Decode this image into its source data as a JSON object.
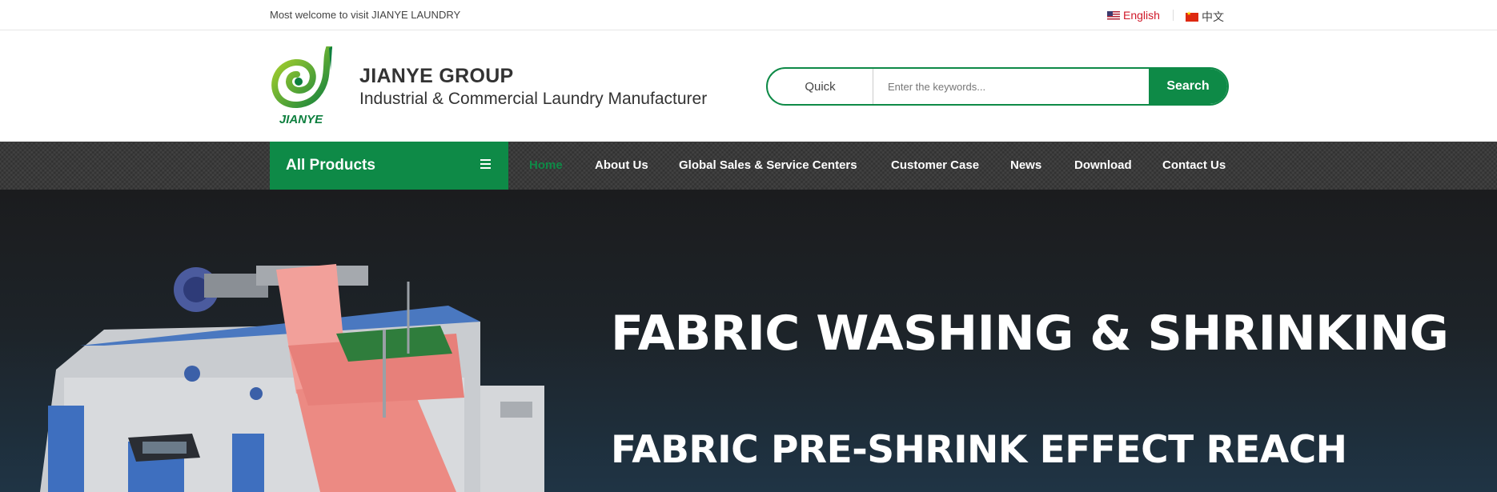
{
  "topbar": {
    "welcome": "Most welcome to visit JIANYE LAUNDRY",
    "lang_en": "English",
    "lang_cn": "中文"
  },
  "header": {
    "logo_text": "JIANYE",
    "brand_title": "JIANYE GROUP",
    "brand_subtitle": "Industrial & Commercial Laundry Manufacturer",
    "search": {
      "quick_label": "Quick",
      "placeholder": "Enter the keywords...",
      "button_label": "Search"
    }
  },
  "nav": {
    "all_products": "All Products",
    "items": [
      "Home",
      "About Us",
      "Global Sales & Service Centers",
      "Customer Case",
      "News",
      "Download",
      "Contact Us"
    ]
  },
  "hero": {
    "title_line1": "FABRIC WASHING & SHRINKING",
    "title_line2": "FABRIC PRE-SHRINK EFFECT REACH"
  },
  "colors": {
    "brand_green": "#0e8a47",
    "accent_red": "#d0192a",
    "nav_bg": "#3a3a3a",
    "hero_bg": "#1d2328"
  }
}
